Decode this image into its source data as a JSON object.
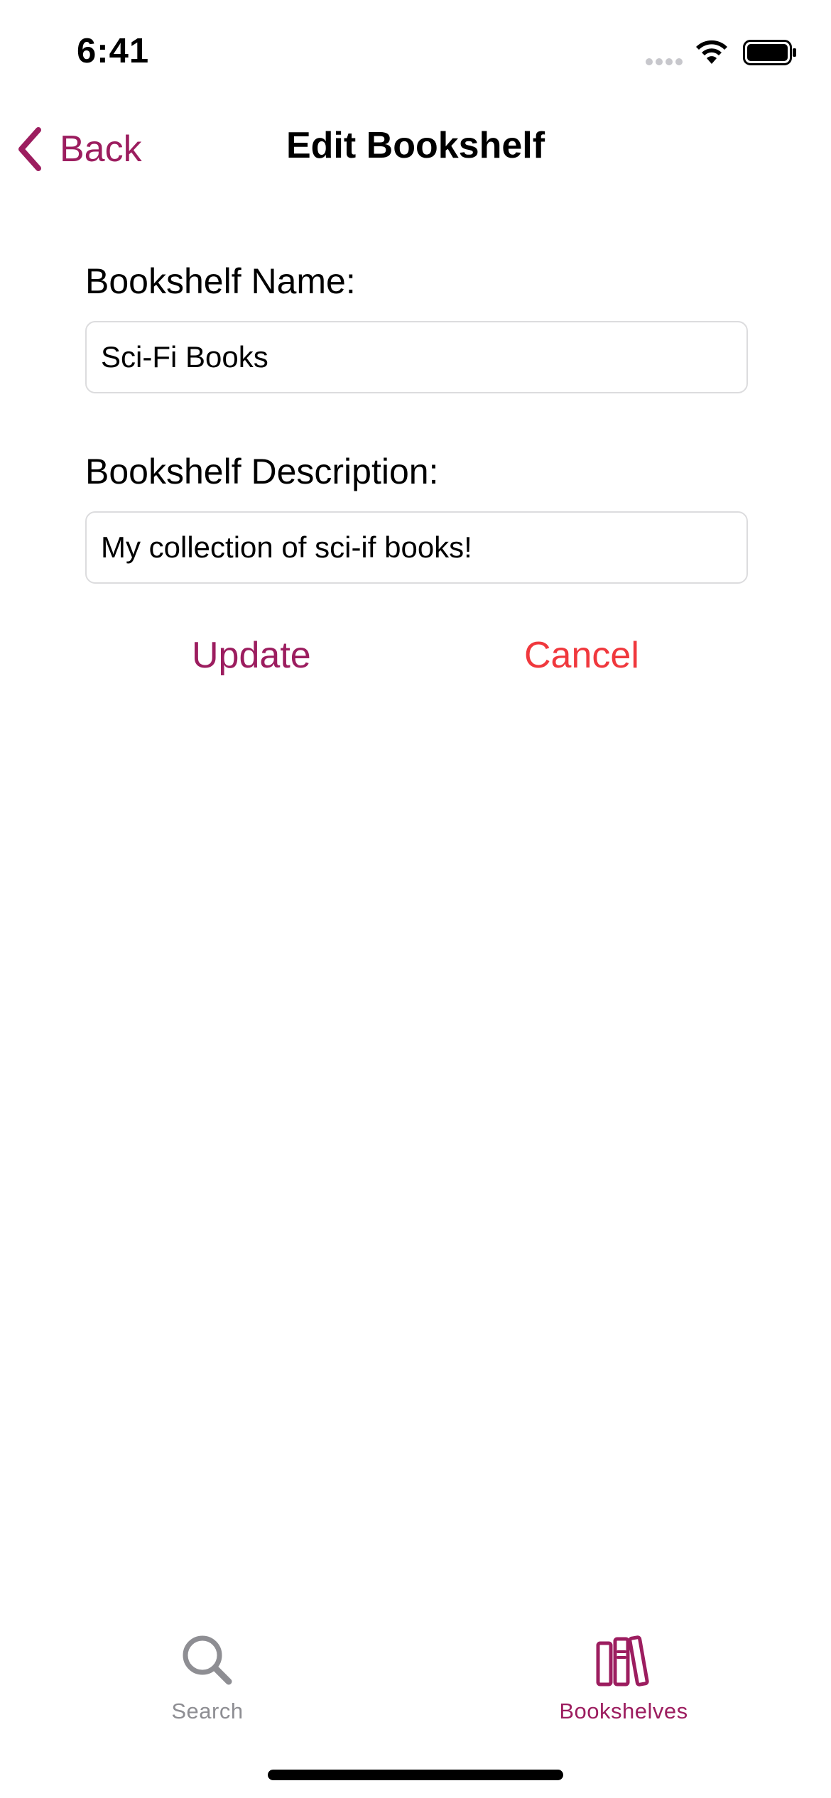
{
  "status_bar": {
    "time": "6:41",
    "icons": [
      "signal-icon",
      "wifi-icon",
      "battery-icon"
    ]
  },
  "nav": {
    "back_label": "Back",
    "title": "Edit Bookshelf",
    "back_icon": "chevron-left-icon"
  },
  "form": {
    "name_label": "Bookshelf Name:",
    "name_value": "Sci-Fi Books",
    "description_label": "Bookshelf Description:",
    "description_value": "My collection of sci-if books!"
  },
  "actions": {
    "update_label": "Update",
    "cancel_label": "Cancel"
  },
  "tab_bar": {
    "tabs": [
      {
        "label": "Search",
        "icon": "search-icon",
        "selected": false
      },
      {
        "label": "Bookshelves",
        "icon": "books-icon",
        "selected": true
      }
    ]
  },
  "colors": {
    "accent": "#9c1d5f",
    "destructive": "#f0383d",
    "inactive": "#8e8e93",
    "field_border": "#dcdcde"
  }
}
